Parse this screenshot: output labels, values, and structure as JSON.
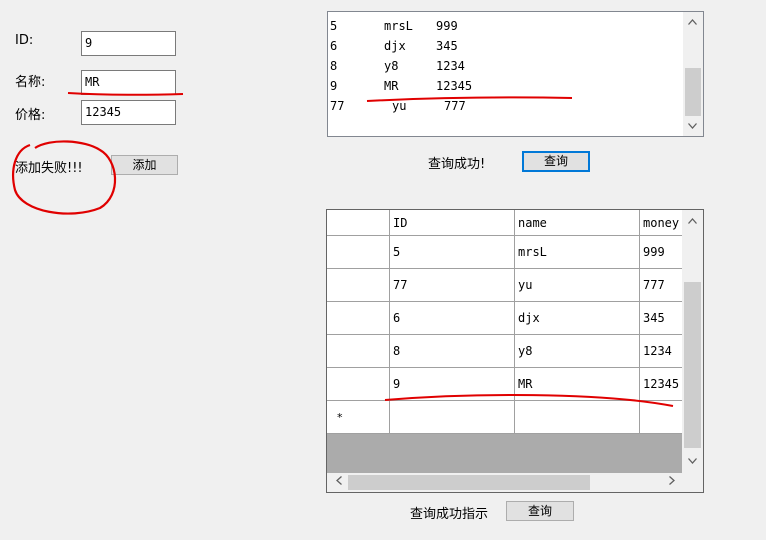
{
  "form": {
    "id_label": "ID:",
    "id_value": "9",
    "name_label": "名称:",
    "name_value": "MR",
    "price_label": "价格:",
    "price_value": "12345",
    "status": "添加失败!!!",
    "add_button": "添加"
  },
  "listbox": {
    "rows": [
      {
        "id": "5",
        "name": "mrsL",
        "money": "999"
      },
      {
        "id": "6",
        "name": "djx",
        "money": "345"
      },
      {
        "id": "8",
        "name": "y8",
        "money": "1234"
      },
      {
        "id": "9",
        "name": "MR",
        "money": "12345"
      },
      {
        "id": "77",
        "name": "yu",
        "money": "777"
      }
    ],
    "status": "查询成功!",
    "query_button": "查询"
  },
  "grid": {
    "columns": [
      "ID",
      "name",
      "money"
    ],
    "rows": [
      [
        "5",
        "mrsL",
        "999"
      ],
      [
        "77",
        "yu",
        "777"
      ],
      [
        "6",
        "djx",
        "345"
      ],
      [
        "8",
        "y8",
        "1234"
      ],
      [
        "9",
        "MR",
        "12345"
      ]
    ],
    "new_row_marker": "*",
    "status": "查询成功指示",
    "query_button": "查询"
  },
  "icons": {
    "scroll_up": "chevron-up-icon",
    "scroll_down": "chevron-down-icon",
    "scroll_left": "chevron-left-icon",
    "scroll_right": "chevron-right-icon"
  },
  "colors": {
    "annotation": "#e00000",
    "focus": "#0078d7"
  }
}
